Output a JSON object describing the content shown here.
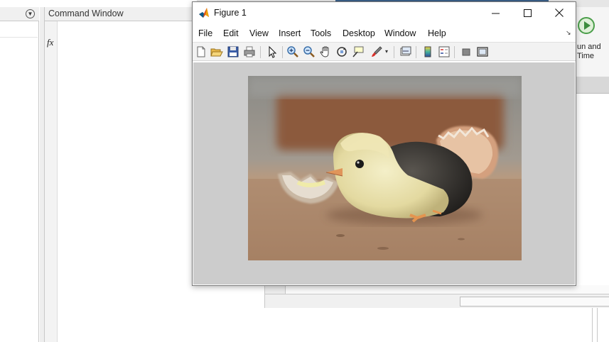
{
  "desktop": {
    "command_window_title": "Command Window",
    "fx_label": "fx",
    "run_button_label": "un and\nTime"
  },
  "figure": {
    "title": "Figure 1",
    "menus": [
      "File",
      "Edit",
      "View",
      "Insert",
      "Tools",
      "Desktop",
      "Window",
      "Help"
    ],
    "toolbar_icons": [
      "new-figure-icon",
      "open-file-icon",
      "save-icon",
      "print-icon",
      "select-arrow-icon",
      "zoom-in-icon",
      "zoom-out-icon",
      "pan-hand-icon",
      "rotate-3d-icon",
      "data-cursor-icon",
      "brush-icon",
      "link-plot-icon",
      "colorbar-icon",
      "legend-icon",
      "hide-plot-tools-icon",
      "show-plot-tools-icon"
    ],
    "image_description_icon": "chick-photo",
    "colors": {
      "canvas_bg": "#cccccc",
      "toolbar_bg": "#f2f2f2"
    }
  }
}
